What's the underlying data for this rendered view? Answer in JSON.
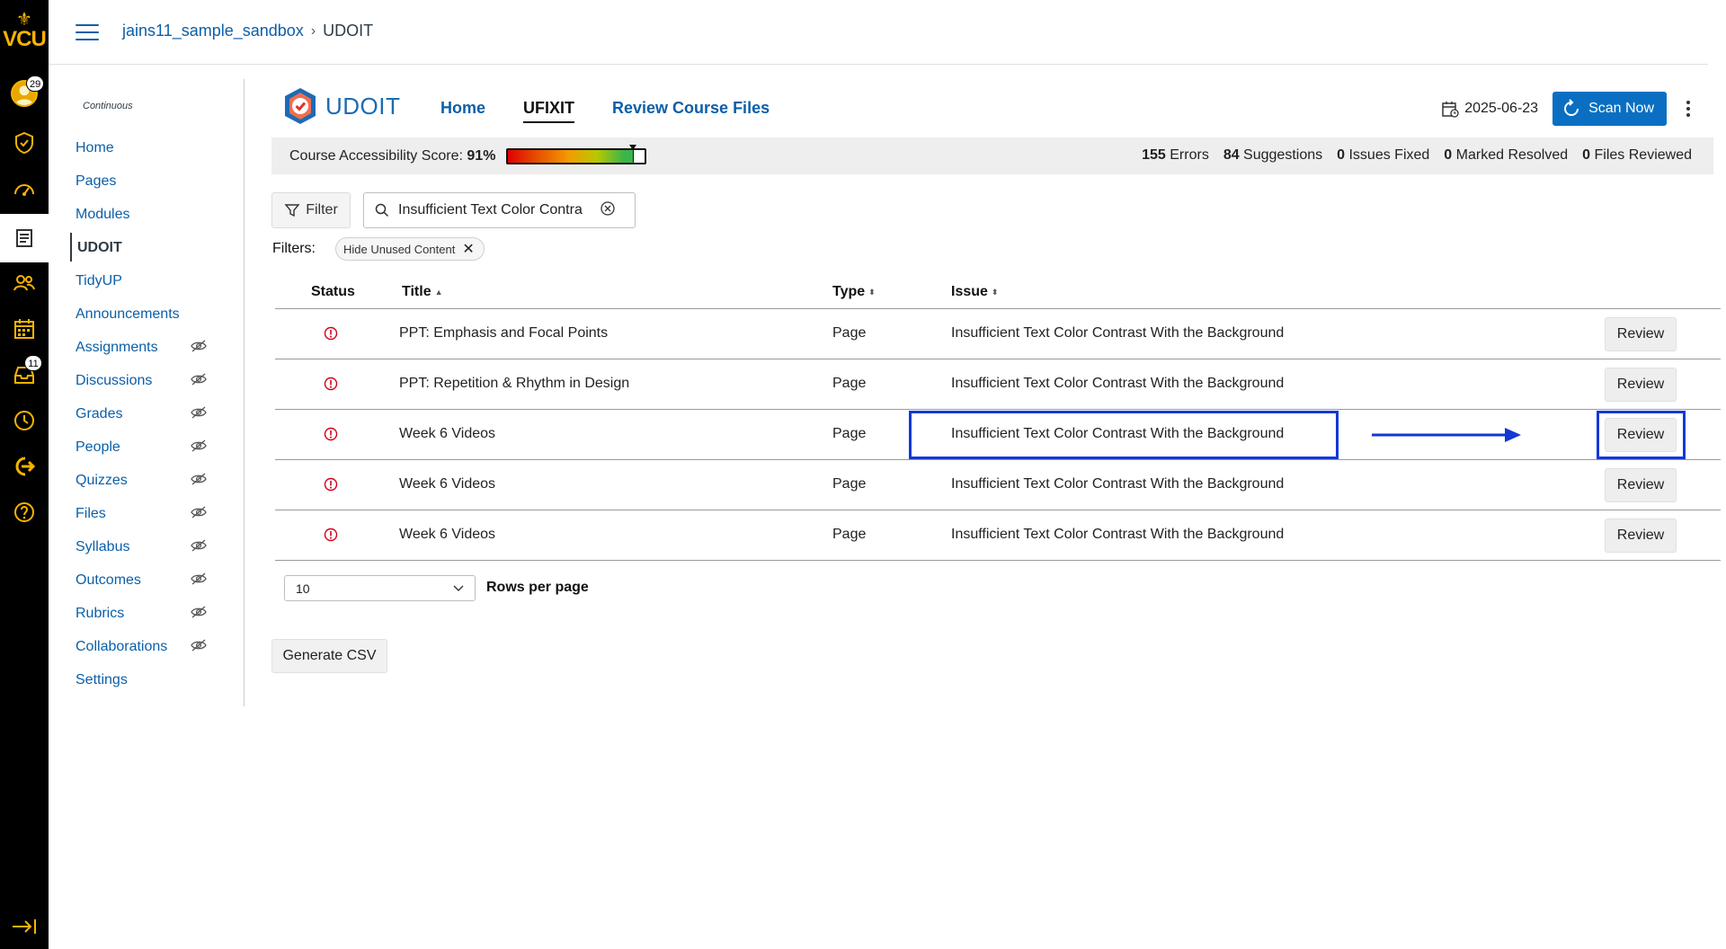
{
  "global_nav": {
    "logo_text": "VCU",
    "profile_badge": "29",
    "inbox_badge": "11",
    "icons": [
      "account-icon",
      "admin-icon",
      "dashboard-icon",
      "courses-icon",
      "groups-icon",
      "calendar-icon",
      "inbox-icon",
      "history-icon",
      "commons-icon",
      "help-icon",
      "collapse-icon"
    ],
    "accent_color": "#f8b300"
  },
  "header": {
    "breadcrumb": [
      "jains11_sample_sandbox",
      "UDOIT"
    ],
    "separator": "›"
  },
  "course_nav": {
    "term": "Continuous",
    "items": [
      {
        "label": "Home",
        "hidden": false
      },
      {
        "label": "Pages",
        "hidden": false
      },
      {
        "label": "Modules",
        "hidden": false
      },
      {
        "label": "UDOIT",
        "hidden": false,
        "active": true
      },
      {
        "label": "TidyUP",
        "hidden": false
      },
      {
        "label": "Announcements",
        "hidden": false
      },
      {
        "label": "Assignments",
        "hidden": true
      },
      {
        "label": "Discussions",
        "hidden": true
      },
      {
        "label": "Grades",
        "hidden": true
      },
      {
        "label": "People",
        "hidden": true
      },
      {
        "label": "Quizzes",
        "hidden": true
      },
      {
        "label": "Files",
        "hidden": true
      },
      {
        "label": "Syllabus",
        "hidden": true
      },
      {
        "label": "Outcomes",
        "hidden": true
      },
      {
        "label": "Rubrics",
        "hidden": true
      },
      {
        "label": "Collaborations",
        "hidden": true
      },
      {
        "label": "Settings",
        "hidden": false
      }
    ]
  },
  "udoit": {
    "logo_text": "UDOIT",
    "tabs": [
      {
        "label": "Home",
        "selected": false
      },
      {
        "label": "UFIXIT",
        "selected": true
      },
      {
        "label": "Review Course Files",
        "selected": false
      }
    ],
    "date": "2025-06-23",
    "scan_label": "Scan Now"
  },
  "score": {
    "label": "Course Accessibility Score: ",
    "value_text": "91%",
    "value": 91,
    "stats": [
      {
        "count": "155",
        "label": " Errors"
      },
      {
        "count": "84",
        "label": " Suggestions"
      },
      {
        "count": "0",
        "label": " Issues Fixed"
      },
      {
        "count": "0",
        "label": " Marked Resolved"
      },
      {
        "count": "0",
        "label": " Files Reviewed"
      }
    ]
  },
  "filters": {
    "filter_label": "Filter",
    "search_value": "Insufficient Text Color Contra",
    "filters_label": "Filters:",
    "chip_label": "Hide Unused Content"
  },
  "table": {
    "headers": {
      "status": "Status",
      "title": "Title",
      "type": "Type",
      "issue": "Issue"
    },
    "sort_asc": "▲",
    "sort_both": "⬍",
    "rows": [
      {
        "title": "PPT: Emphasis and Focal Points",
        "type": "Page",
        "issue": "Insufficient Text Color Contrast With the Background",
        "action": "Review"
      },
      {
        "title": "PPT: Repetition & Rhythm in Design",
        "type": "Page",
        "issue": "Insufficient Text Color Contrast With the Background",
        "action": "Review"
      },
      {
        "title": "Week 6 Videos",
        "type": "Page",
        "issue": "Insufficient Text Color Contrast With the Background",
        "action": "Review",
        "highlighted": true
      },
      {
        "title": "Week 6 Videos",
        "type": "Page",
        "issue": "Insufficient Text Color Contrast With the Background",
        "action": "Review"
      },
      {
        "title": "Week 6 Videos",
        "type": "Page",
        "issue": "Insufficient Text Color Contrast With the Background",
        "action": "Review"
      }
    ],
    "error_color": "#d0021b",
    "highlight_color": "#1238d6"
  },
  "pagination": {
    "rows_per_page_value": "10",
    "rows_per_page_label": "Rows per page"
  },
  "csv_button": "Generate CSV"
}
